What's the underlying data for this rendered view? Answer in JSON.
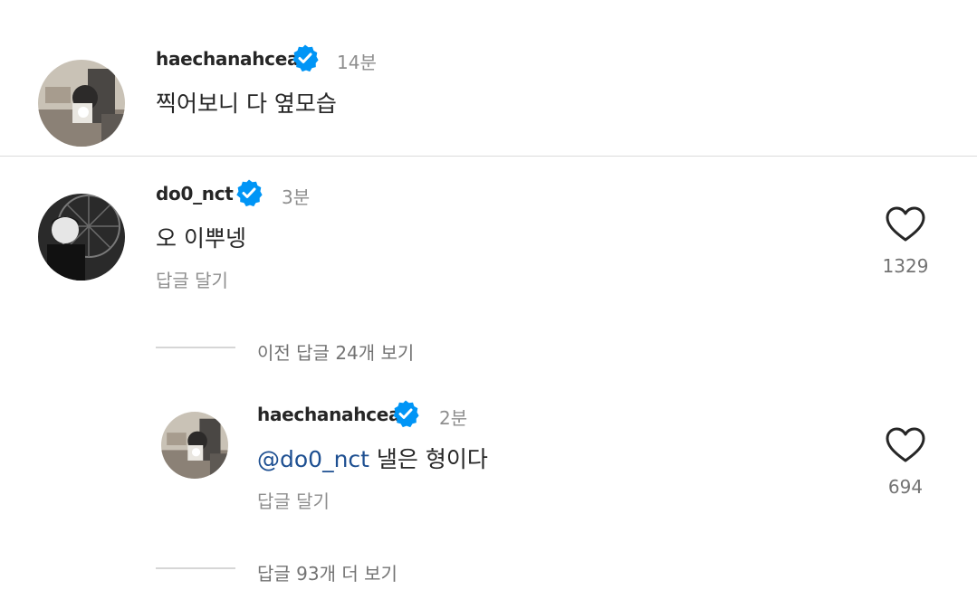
{
  "comments": [
    {
      "username": "haechanahceah",
      "time": "14분",
      "text": "찍어보니 다 옆모습"
    },
    {
      "username": "do0_nct",
      "time": "3분",
      "text": "오 이뿌넹",
      "reply_label": "답글 달기",
      "like_count": "1329"
    }
  ],
  "view_previous_replies": "이전 답글 24개 보기",
  "reply": {
    "username": "haechanahceah",
    "time": "2분",
    "mention": "@do0_nct",
    "text": " 낼은 형이다",
    "reply_label": "답글 달기",
    "like_count": "694"
  },
  "view_more_replies": "답글 93개 더 보기",
  "colors": {
    "verified_blue": "#0095f6",
    "mention": "#1d4f91",
    "secondary_text": "#8e8e8e"
  },
  "icons": {
    "verified": "verified-badge-icon",
    "like": "heart-outline-icon"
  }
}
